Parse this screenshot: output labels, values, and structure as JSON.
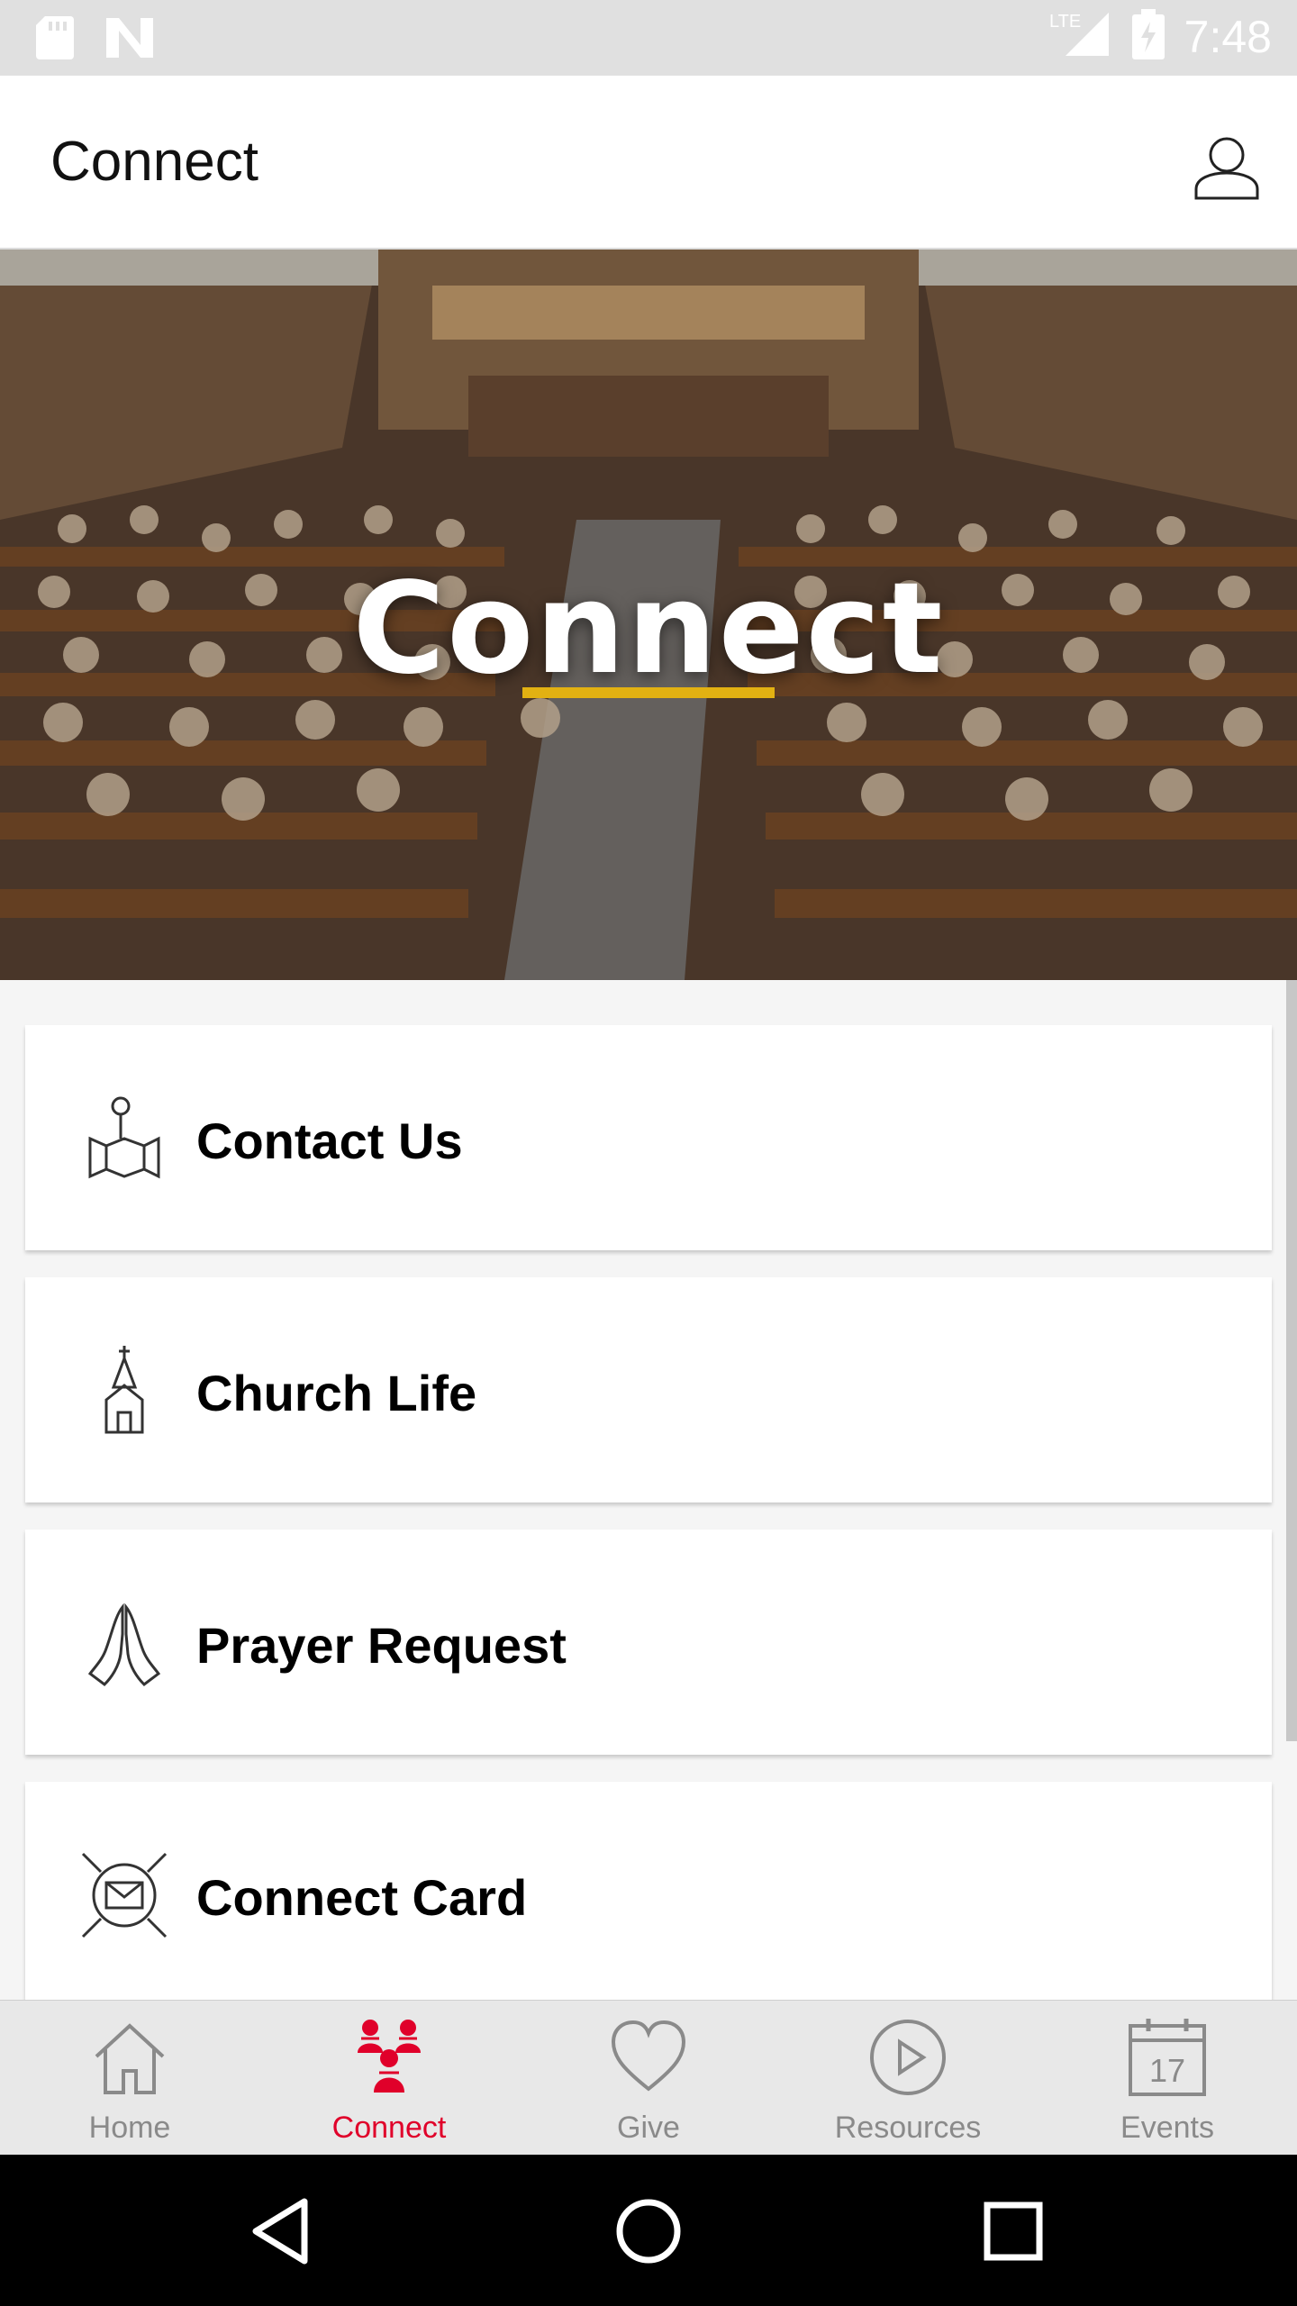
{
  "status_bar": {
    "time": "7:48",
    "network": "LTE",
    "icons": [
      "sd-card-icon",
      "notification-n-icon",
      "signal-icon",
      "battery-charging-icon"
    ]
  },
  "app_bar": {
    "title": "Connect",
    "profile_icon": "person-outline-icon"
  },
  "hero": {
    "title": "Connect",
    "underline_color": "#e2b112"
  },
  "cards": [
    {
      "label": "Contact Us",
      "icon": "map-pin-icon"
    },
    {
      "label": "Church Life",
      "icon": "church-icon"
    },
    {
      "label": "Prayer Request",
      "icon": "praying-hands-icon"
    },
    {
      "label": "Connect Card",
      "icon": "envelope-icon"
    }
  ],
  "tabs": [
    {
      "label": "Home",
      "icon": "home-icon",
      "active": false
    },
    {
      "label": "Connect",
      "icon": "people-icon",
      "active": true
    },
    {
      "label": "Give",
      "icon": "heart-icon",
      "active": false
    },
    {
      "label": "Resources",
      "icon": "play-circle-icon",
      "active": false
    },
    {
      "label": "Events",
      "icon": "calendar-icon",
      "active": false,
      "calendar_day": "17"
    }
  ],
  "colors": {
    "active_tab": "#e0002a",
    "inactive_tab": "#8a8a8a",
    "accent": "#e2b112"
  }
}
